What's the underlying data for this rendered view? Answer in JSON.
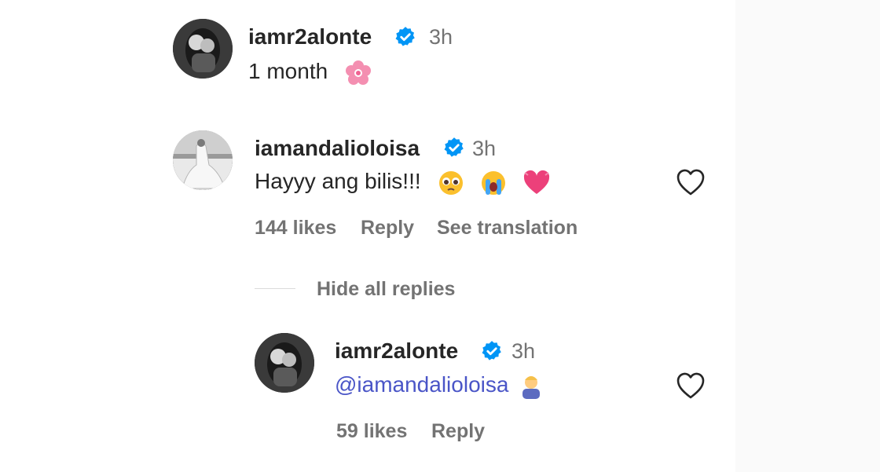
{
  "comments": [
    {
      "username": "iamr2alonte",
      "time": "3h",
      "text": "1 month",
      "emoji": "flower-icon"
    },
    {
      "username": "iamandalioloisa",
      "time": "3h",
      "text": "Hayyy ang bilis!!!",
      "emojis": [
        "pleading-face-icon",
        "crying-face-icon",
        "growing-heart-icon"
      ],
      "likes": "144 likes",
      "reply_label": "Reply",
      "translate_label": "See translation"
    }
  ],
  "replies_toggle": "Hide all replies",
  "reply": {
    "username": "iamr2alonte",
    "time": "3h",
    "mention": "@iamandalioloisa",
    "emoji": "person-bowing-icon",
    "likes": "59 likes",
    "reply_label": "Reply"
  },
  "colors": {
    "text": "#262626",
    "muted": "#737373",
    "verified": "#0095f6",
    "mention": "#4a55c7"
  }
}
